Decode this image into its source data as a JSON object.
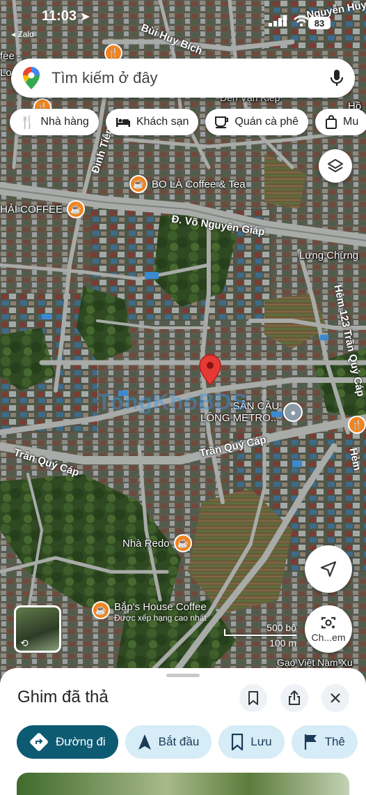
{
  "status_bar": {
    "time": "11:03",
    "back_app": "◂ Zalo",
    "battery": "83"
  },
  "search": {
    "placeholder": "Tìm kiếm ở đây"
  },
  "chips": [
    {
      "label": "Nhà hàng",
      "icon": "restaurant-icon"
    },
    {
      "label": "Khách sạn",
      "icon": "hotel-icon"
    },
    {
      "label": "Quán cà phê",
      "icon": "coffee-icon"
    },
    {
      "label": "Mu",
      "icon": "shopping-icon"
    }
  ],
  "map": {
    "streets": {
      "bui_huy_bich": "Bùi Huy Bích",
      "nguyen_huy": "Nguyễn Huy",
      "dinh_tien_hoang": "Đinh Tiên H",
      "vo_nguyen_giap": "Đ. Võ Nguyên Giáp",
      "tran_quy_cap_left": "Trần Quý Cáp",
      "tran_quy_cap_center": "Trần Quý Cáp",
      "hem_123": "Hẻm 123 Trần Quý Cáp",
      "hem_right": "Hẻm",
      "luong_chung": "Lưng Chừng",
      "den_van_kiep": "Đền Vạn Kiếp",
      "ho": "Hồ",
      "fee": "fee -",
      "lo": "Lo",
      "gao_viet_nam": "Gạo Việt Nam Xu"
    },
    "places": {
      "bo_la": "BO LÀ Coffee & Tea",
      "hai_coffee": "HẢI COFFEE",
      "san_cau_long_1": "SÂN CẦU",
      "san_cau_long_2": "LÔNG METRO...",
      "nha_redo": "Nhà Redo",
      "baps_house": "Bắp's House Coffee",
      "baps_house_sub": "Được xếp hạng cao nhất"
    },
    "watermark": "TongKhoBDS",
    "scale": {
      "imperial": "500 bộ",
      "metric": "100 m"
    },
    "street_view_label": "Ch...em"
  },
  "sheet": {
    "title": "Ghim đã thả",
    "actions": [
      {
        "label": "Đường đi",
        "icon": "directions-icon"
      },
      {
        "label": "Bắt đầu",
        "icon": "navigation-arrow-icon"
      },
      {
        "label": "Lưu",
        "icon": "bookmark-icon"
      },
      {
        "label": "Thê",
        "icon": "flag-icon"
      }
    ]
  },
  "colors": {
    "poi_orange": "#f0841f",
    "pin_red": "#e53935",
    "primary_action": "#0d5a73",
    "action_bg": "#d6ecf7"
  }
}
